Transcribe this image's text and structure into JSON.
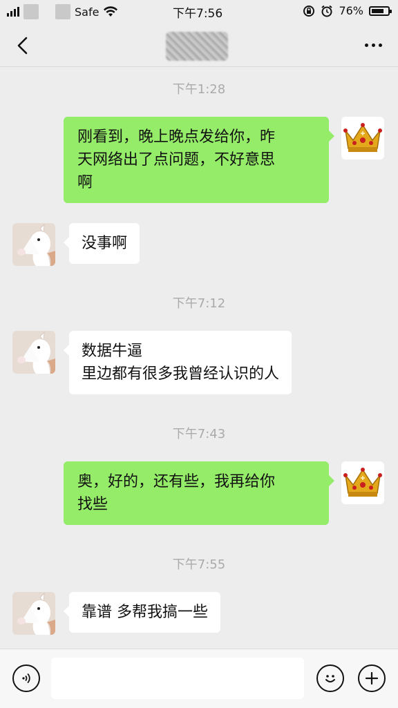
{
  "status": {
    "carrier_partial": "Safe",
    "time": "下午7:56",
    "battery": "76%",
    "battery_level": 0.76
  },
  "nav": {
    "back_icon": "chevron-left-icon",
    "more_icon": "more-horizontal-icon"
  },
  "messages": [
    {
      "type": "time",
      "text": "下午1:28"
    },
    {
      "type": "out",
      "lines": [
        "刚看到，晚上晚点发给你，昨",
        "天网络出了点问题，不好意思",
        "啊"
      ]
    },
    {
      "type": "in",
      "lines": [
        "没事啊"
      ]
    },
    {
      "type": "time",
      "text": "下午7:12"
    },
    {
      "type": "in",
      "lines": [
        "数据牛逼",
        "里边都有很多我曾经认识的人"
      ]
    },
    {
      "type": "time",
      "text": "下午7:43"
    },
    {
      "type": "out",
      "lines": [
        "奥，好的，还有些，我再给你",
        "找些"
      ]
    },
    {
      "type": "time",
      "text": "下午7:55"
    },
    {
      "type": "in",
      "lines": [
        "靠谱 多帮我搞一些"
      ]
    }
  ],
  "input": {
    "value": "",
    "voice_icon": "voice-icon",
    "emoji_icon": "emoji-icon",
    "add_icon": "plus-icon"
  },
  "colors": {
    "background": "#ededed",
    "outgoing_bubble": "#95ec69",
    "incoming_bubble": "#ffffff",
    "timestamp": "#aaaaaa"
  }
}
